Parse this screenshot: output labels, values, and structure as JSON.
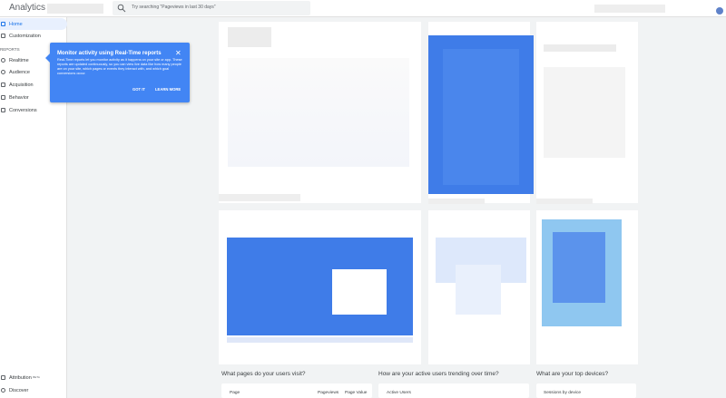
{
  "header": {
    "app_title": "Analytics",
    "search_placeholder": "Try searching \"Pageviews in last 30 days\""
  },
  "sidebar": {
    "section_label": "REPORTS",
    "items": [
      {
        "label": "Home",
        "icon": "home-icon"
      },
      {
        "label": "Customization",
        "icon": "customization-icon"
      },
      {
        "label": "Realtime",
        "icon": "clock-icon"
      },
      {
        "label": "Audience",
        "icon": "person-icon"
      },
      {
        "label": "Acquisition",
        "icon": "acquisition-icon"
      },
      {
        "label": "Behavior",
        "icon": "behavior-icon"
      },
      {
        "label": "Conversions",
        "icon": "flag-icon"
      }
    ],
    "bottom_items": [
      {
        "label": "Attribution",
        "badge": "BETA",
        "icon": "attribution-icon"
      },
      {
        "label": "Discover",
        "icon": "discover-icon"
      }
    ]
  },
  "tooltip": {
    "title": "Monitor activity using Real-Time reports",
    "body": "Real-Time reports let you monitor activity as it happens on your site or app. These reports are updated continuously, so you can view live data like how many people are on your site, which pages or events they interact with, and which goal conversions occur.",
    "got_it": "GOT IT",
    "learn_more": "LEARN MORE"
  },
  "bottom": {
    "pages_title": "What pages do your users visit?",
    "pages_col_page": "Page",
    "pages_col_pageviews": "Pageviews",
    "pages_col_value": "Page Value",
    "trend_title": "How are your active users trending over time?",
    "trend_label": "Active Users",
    "devices_title": "What are your top devices?",
    "devices_label": "Sessions by device"
  },
  "colors": {
    "accent": "#1a73e8",
    "tooltip_bg": "#4285f4",
    "chart_blue": "#3f7ce8"
  }
}
